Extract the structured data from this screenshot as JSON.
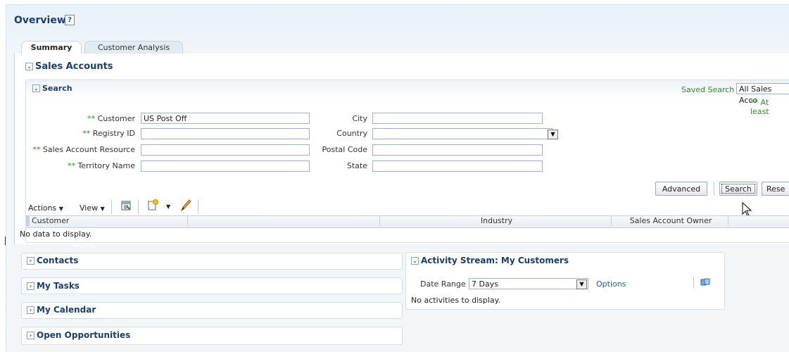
{
  "page": {
    "title": "Overview",
    "help_icon": "?"
  },
  "tabs": [
    {
      "label": "Summary",
      "selected": true
    },
    {
      "label": "Customer Analysis",
      "selected": false
    }
  ],
  "sales_accounts": {
    "title": "Sales Accounts",
    "search": {
      "title": "Search",
      "saved_search_label": "Saved Search",
      "saved_search_value": "All Sales Acco",
      "at_least_note": "** At least",
      "fields_left": [
        {
          "req": "**",
          "label": "Customer",
          "value": "US Post Off"
        },
        {
          "req": "**",
          "label": "Registry ID",
          "value": ""
        },
        {
          "req": "**",
          "label": "Sales Account Resource",
          "value": ""
        },
        {
          "req": "**",
          "label": "Territory Name",
          "value": ""
        }
      ],
      "fields_right": [
        {
          "label": "City",
          "value": ""
        },
        {
          "label": "Country",
          "value": ""
        },
        {
          "label": "Postal Code",
          "value": ""
        },
        {
          "label": "State",
          "value": ""
        }
      ],
      "buttons": {
        "advanced": "Advanced",
        "search": "Search",
        "reset": "Rese"
      }
    },
    "toolbar": {
      "actions": "Actions",
      "view": "View"
    },
    "table": {
      "columns": [
        "Customer",
        "",
        "Industry",
        "Sales Account Owner",
        ""
      ],
      "empty_message": "No data to display."
    }
  },
  "panels": {
    "contacts": "Contacts",
    "my_tasks": "My Tasks",
    "my_calendar": "My Calendar",
    "open_opportunities": "Open Opportunities"
  },
  "activity_stream": {
    "title": "Activity Stream: My Customers",
    "date_range_label": "Date Range",
    "date_range_value": "7 Days",
    "options_link": "Options",
    "empty_message": "No activities to display."
  },
  "icons": {
    "disclosure_open": "⌄",
    "disclosure_closed": "›"
  },
  "colors": {
    "header_text": "#1b3f6c",
    "required_marker": "#2c8d2c",
    "link": "#1f5a96"
  }
}
